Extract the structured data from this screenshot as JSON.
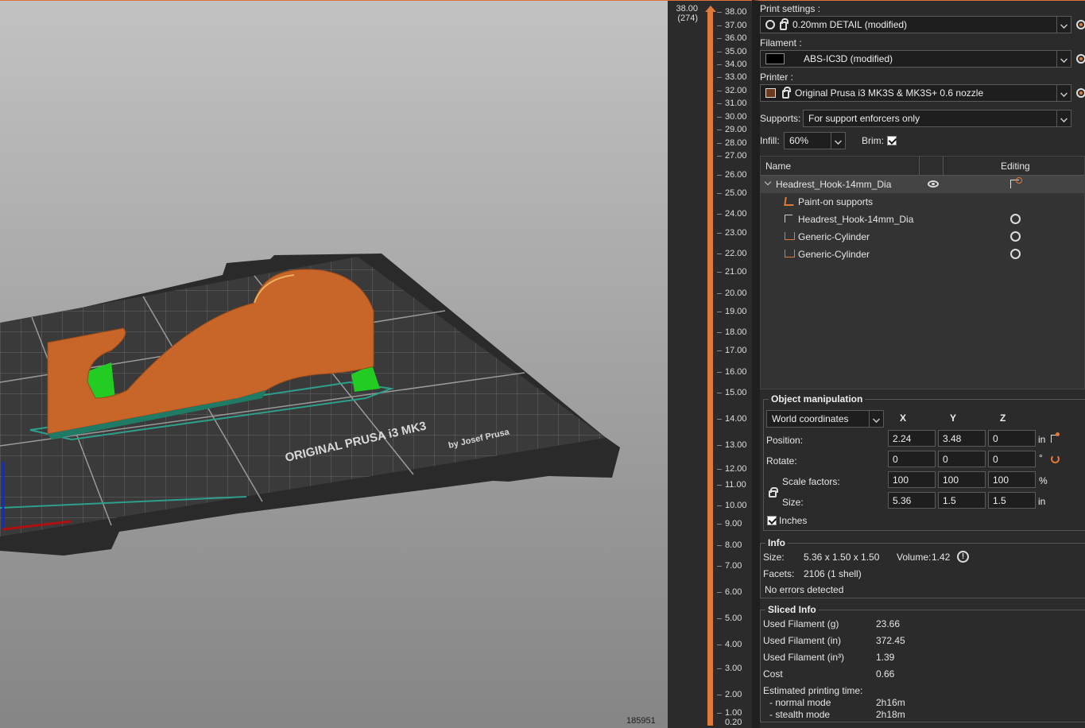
{
  "viewport": {
    "bed_brand": "ORIGINAL PRUSA i3 MK3",
    "bed_sub": "by Josef Prusa",
    "triangle_count": "185951"
  },
  "layer_slider": {
    "top_height": "38.00",
    "top_layer": "(274)",
    "bottom_value": "0.20",
    "ticks": [
      "38.00",
      "37.00",
      "36.00",
      "35.00",
      "34.00",
      "33.00",
      "32.00",
      "31.00",
      "30.00",
      "29.00",
      "28.00",
      "27.00",
      "26.00",
      "25.00",
      "24.00",
      "23.00",
      "22.00",
      "21.00",
      "20.00",
      "19.00",
      "18.00",
      "17.00",
      "16.00",
      "15.00",
      "14.00",
      "13.00",
      "12.00",
      "11.00",
      "10.00",
      "9.00",
      "8.00",
      "7.00",
      "6.00",
      "5.00",
      "4.00",
      "3.00",
      "2.00",
      "1.00"
    ]
  },
  "sidebar": {
    "print_settings_label": "Print settings :",
    "print_settings_value": "0.20mm DETAIL (modified)",
    "filament_label": "Filament :",
    "filament_value": "ABS-IC3D (modified)",
    "printer_label": "Printer :",
    "printer_value": "Original Prusa i3 MK3S & MK3S+ 0.6 nozzle",
    "supports_label": "Supports:",
    "supports_value": "For support enforcers only",
    "infill_label": "Infill:",
    "infill_value": "60%",
    "brim_label": "Brim:",
    "brim_checked": true
  },
  "object_list": {
    "col_name": "Name",
    "col_editing": "Editing",
    "rows": [
      {
        "label": "Headrest_Hook-14mm_Dia"
      },
      {
        "label": "Paint-on supports"
      },
      {
        "label": "Headrest_Hook-14mm_Dia"
      },
      {
        "label": "Generic-Cylinder"
      },
      {
        "label": "Generic-Cylinder"
      }
    ]
  },
  "object_manipulation": {
    "title": "Object manipulation",
    "coord_system": "World coordinates",
    "axis_x": "X",
    "axis_y": "Y",
    "axis_z": "Z",
    "position_label": "Position:",
    "position": [
      "2.24",
      "3.48",
      "0"
    ],
    "position_unit": "in",
    "rotate_label": "Rotate:",
    "rotate": [
      "0",
      "0",
      "0"
    ],
    "rotate_unit": "°",
    "scale_label": "Scale factors:",
    "scale": [
      "100",
      "100",
      "100"
    ],
    "scale_unit": "%",
    "size_label": "Size:",
    "size": [
      "5.36",
      "1.5",
      "1.5"
    ],
    "size_unit": "in",
    "inches_label": "Inches"
  },
  "info": {
    "title": "Info",
    "size_label": "Size:",
    "size_value": "5.36 x 1.50 x 1.50",
    "volume_label": "Volume:",
    "volume_value": "1.42",
    "facets_label": "Facets:",
    "facets_value": "2106 (1 shell)",
    "errors": "No errors detected"
  },
  "sliced_info": {
    "title": "Sliced Info",
    "rows": [
      {
        "label": "Used Filament (g)",
        "value": "23.66"
      },
      {
        "label": "Used Filament (in)",
        "value": "372.45"
      },
      {
        "label": "Used Filament (in³)",
        "value": "1.39"
      },
      {
        "label": "Cost",
        "value": "0.66"
      }
    ],
    "time_label": "Estimated printing time:",
    "normal_label": "- normal mode",
    "normal_value": "2h16m",
    "stealth_label": "- stealth mode",
    "stealth_value": "2h18m"
  }
}
